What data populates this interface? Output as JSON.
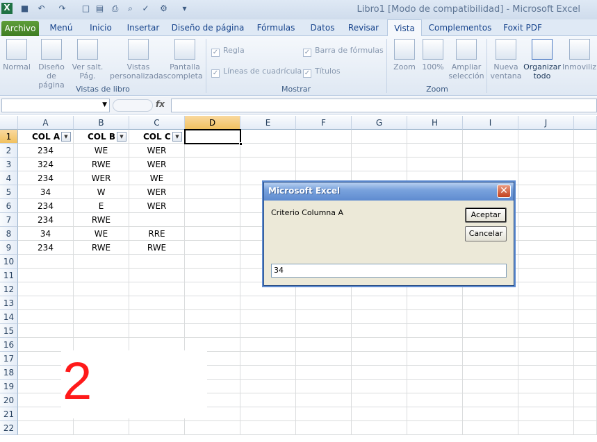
{
  "window": {
    "title": "Libro1  [Modo de compatibilidad]  -  Microsoft Excel"
  },
  "quick_access": [
    {
      "icon": "excel-logo-icon",
      "glyph": "X"
    },
    {
      "icon": "save-icon",
      "glyph": "■"
    },
    {
      "icon": "undo-icon",
      "glyph": "↶"
    },
    {
      "icon": "redo-icon",
      "glyph": "↷"
    },
    {
      "icon": "new-icon",
      "glyph": "□"
    },
    {
      "icon": "open-icon",
      "glyph": "▤"
    },
    {
      "icon": "print-icon",
      "glyph": "⎙"
    },
    {
      "icon": "print-preview-icon",
      "glyph": "⌕"
    },
    {
      "icon": "spelling-icon",
      "glyph": "✓"
    },
    {
      "icon": "tools-icon",
      "glyph": "⚙"
    },
    {
      "icon": "customize-icon",
      "glyph": "▾"
    }
  ],
  "tabs": [
    "Archivo",
    "Menú",
    "Inicio",
    "Insertar",
    "Diseño de página",
    "Fórmulas",
    "Datos",
    "Revisar",
    "Vista",
    "Complementos",
    "Foxit PDF"
  ],
  "active_tab": "Vista",
  "ribbon": {
    "vistas": [
      {
        "label1": "Normal",
        "label2": ""
      },
      {
        "label1": "Diseño",
        "label2": "de página"
      },
      {
        "label1": "Ver salt.",
        "label2": "Pág."
      },
      {
        "label1": "Vistas",
        "label2": "personalizadas"
      },
      {
        "label1": "Pantalla",
        "label2": "completa"
      }
    ],
    "group_vistas": "Vistas de libro",
    "mostrar": [
      "Regla",
      "Líneas de cuadrícula",
      "Barra de fórmulas",
      "Títulos"
    ],
    "group_mostrar": "Mostrar",
    "zoom": [
      {
        "label1": "Zoom",
        "label2": ""
      },
      {
        "label1": "100%",
        "label2": ""
      },
      {
        "label1": "Ampliar",
        "label2": "selección"
      }
    ],
    "group_zoom": "Zoom",
    "ventana": [
      {
        "label1": "Nueva",
        "label2": "ventana"
      },
      {
        "label1": "Organizar",
        "label2": "todo"
      },
      {
        "label1": "Inmoviliz",
        "label2": ""
      }
    ]
  },
  "formula_bar": {
    "fx": "fx",
    "name_box": "",
    "formula": ""
  },
  "columns": [
    "A",
    "B",
    "C",
    "D",
    "E",
    "F",
    "G",
    "H",
    "I",
    "J"
  ],
  "rows": [
    "1",
    "2",
    "3",
    "4",
    "5",
    "6",
    "7",
    "8",
    "9",
    "10",
    "11",
    "12",
    "13",
    "14",
    "15",
    "16",
    "17",
    "18",
    "19",
    "20",
    "21",
    "22"
  ],
  "table": {
    "headers": [
      "COL A",
      "COL B",
      "COL C"
    ],
    "data": [
      [
        "234",
        "WE",
        "WER"
      ],
      [
        "324",
        "RWE",
        "WER"
      ],
      [
        "234",
        "WER",
        "WE"
      ],
      [
        "34",
        "W",
        "WER"
      ],
      [
        "234",
        "E",
        "WER"
      ],
      [
        "234",
        "RWE",
        ""
      ],
      [
        "34",
        "WE",
        "RRE"
      ],
      [
        "234",
        "RWE",
        "RWE"
      ]
    ]
  },
  "dialog": {
    "title": "Microsoft Excel",
    "prompt": "Criterio Columna A",
    "ok_label": "Aceptar",
    "cancel_label": "Cancelar",
    "input_value": "34",
    "close_glyph": "✕"
  },
  "annotation": "2"
}
